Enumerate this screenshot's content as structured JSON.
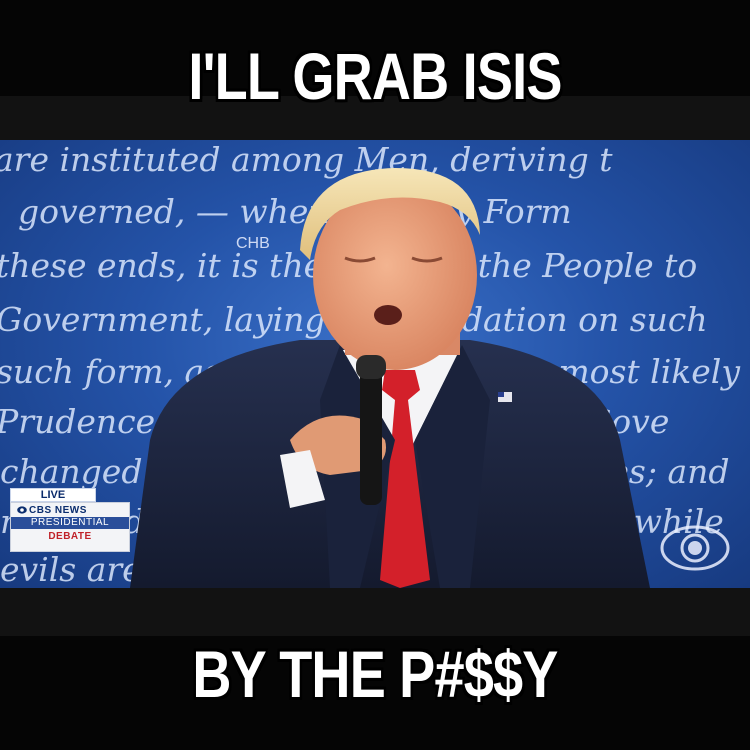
{
  "captions": {
    "top": "I'LL GRAB ISIS",
    "bottom": "BY THE P#$$Y"
  },
  "backdrop": {
    "script_lines": [
      "are instituted among Men, deriving t",
      "governed, — whenever any Form",
      "these ends, it is the Right of the People to",
      "Government, laying its foundation on such",
      "such form, as to them shall seem most likely",
      "Prudence, indeed, will dictate that Gove",
      "changed for light and transient causes; and",
      "   mankind are more disposed to suffer, while",
      "   evils are sufferable, than to right them"
    ],
    "watermark": "CHB"
  },
  "broadcast": {
    "live": "LIVE",
    "network": "CBS NEWS",
    "event_line1": "PRESIDENTIAL",
    "event_line2": "DEBATE"
  },
  "colors": {
    "backdrop_blue": "#2453a8",
    "suit": "#1c2540",
    "tie": "#d3202a",
    "caption_text": "#ffffff"
  },
  "icons": {
    "network_logo": "cbs-eye-icon",
    "lapel_pin": "us-flag-pin-icon"
  }
}
